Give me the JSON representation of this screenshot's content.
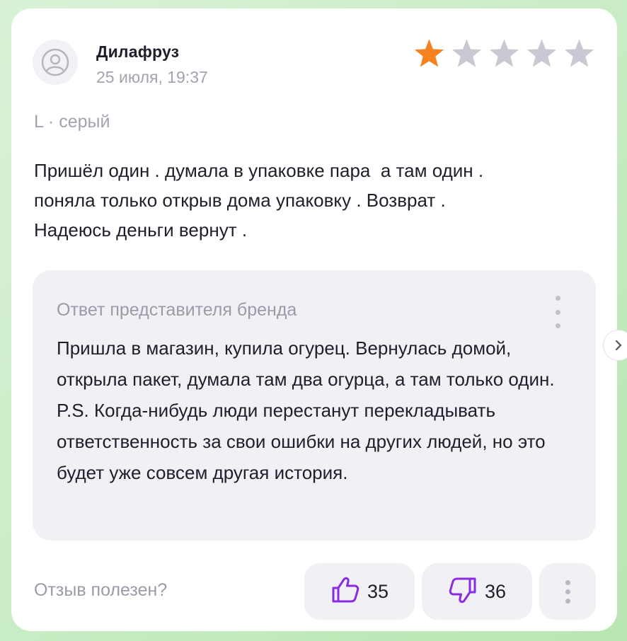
{
  "review": {
    "author": "Дилафруз",
    "date": "25 июля, 19:37",
    "rating": 1,
    "rating_max": 5,
    "variant": "L · серый",
    "text": "Пришёл один . думала в упаковке пара  а там один .\nпоняла только открыв дома упаковку . Возврат .\nНадеюсь деньги вернут ."
  },
  "reply": {
    "title": "Ответ представителя бренда",
    "text": "Пришла в магазин, купила огурец. Вернулась домой, открыла пакет, думала там два огурца, а там только один.  P.S. Когда-нибудь люди перестанут перекладывать ответственность за свои ошибки на других людей, но это будет уже совсем другая история."
  },
  "helpful": {
    "label": "Отзыв полезен?",
    "likes": "35",
    "dislikes": "36"
  },
  "icons": {
    "avatar": "user-circle-icon",
    "star": "star-icon",
    "like": "thumb-up-icon",
    "dislike": "thumb-down-icon",
    "more": "more-vertical-icon",
    "next": "chevron-right-icon"
  },
  "colors": {
    "star_filled": "#f5821f",
    "star_empty": "#c9c9d4",
    "accent": "#8a2be2"
  }
}
